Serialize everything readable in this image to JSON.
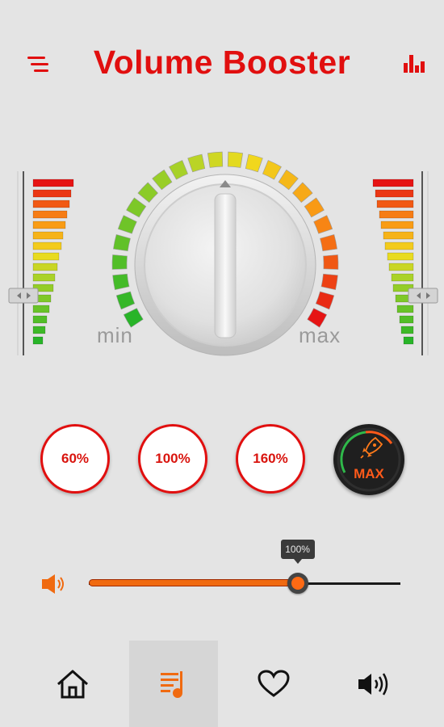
{
  "header": {
    "title": "Volume Booster",
    "menu_icon": "menu-lines-icon",
    "stats_icon": "bar-chart-icon"
  },
  "knob": {
    "min_label": "min",
    "max_label": "max",
    "level_fraction": 1.0
  },
  "presets": [
    {
      "label": "60%"
    },
    {
      "label": "100%"
    },
    {
      "label": "160%"
    }
  ],
  "max_button": {
    "label": "MAX",
    "icon": "rocket-icon"
  },
  "slider": {
    "value_percent": 100,
    "tooltip": "100%",
    "fraction": 0.67,
    "icon": "speaker-icon"
  },
  "nav": [
    {
      "name": "home",
      "icon": "home-icon"
    },
    {
      "name": "music",
      "icon": "music-list-icon",
      "active": true
    },
    {
      "name": "favorite",
      "icon": "heart-icon"
    },
    {
      "name": "volume",
      "icon": "volume-icon"
    }
  ],
  "colors": {
    "brand_red": "#e10f0f",
    "accent_orange": "#f06a10",
    "background": "#e4e4e4"
  }
}
